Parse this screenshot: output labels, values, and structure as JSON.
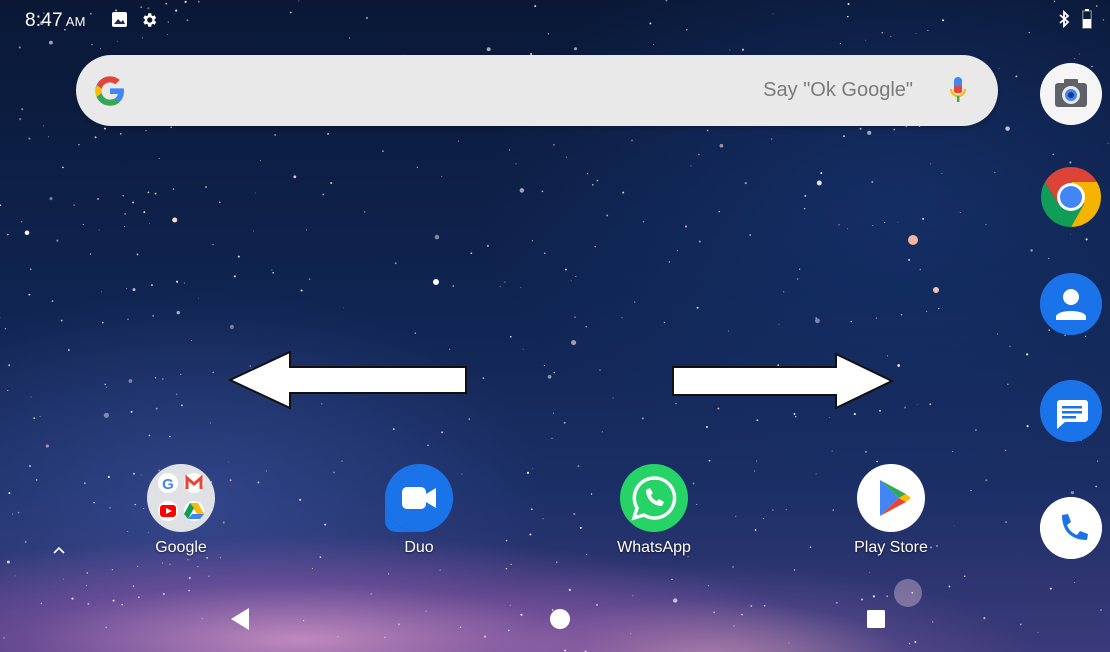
{
  "status_bar": {
    "time": "8:47",
    "ampm": "AM",
    "left_icons": [
      "image-icon",
      "gear-icon"
    ],
    "right_icons": [
      "bluetooth-icon",
      "battery-icon"
    ]
  },
  "search": {
    "logo": "google-g-icon",
    "placeholder": "Say \"Ok Google\"",
    "mic": "mic-icon"
  },
  "dock": [
    {
      "name": "camera",
      "icon": "camera-icon"
    },
    {
      "name": "chrome",
      "icon": "chrome-icon"
    },
    {
      "name": "contacts",
      "icon": "contacts-icon"
    },
    {
      "name": "messages",
      "icon": "messages-icon"
    },
    {
      "name": "phone",
      "icon": "phone-icon"
    }
  ],
  "apps": [
    {
      "label": "Google",
      "icon": "google-folder-icon"
    },
    {
      "label": "Duo",
      "icon": "duo-icon"
    },
    {
      "label": "WhatsApp",
      "icon": "whatsapp-icon"
    },
    {
      "label": "Play Store",
      "icon": "play-store-icon"
    }
  ],
  "navigation": {
    "back": "back-icon",
    "home": "home-icon",
    "recents": "recents-icon"
  },
  "annotations": {
    "arrows": [
      "left-arrow-icon",
      "right-arrow-icon"
    ]
  },
  "colors": {
    "search_bg": "#e9e9ea",
    "duo_blue": "#1a73e8",
    "whatsapp_green": "#25d366",
    "contacts_blue": "#1a73e8",
    "chrome_red": "#db4437",
    "chrome_yellow": "#f4b400",
    "chrome_green": "#0f9d58"
  }
}
